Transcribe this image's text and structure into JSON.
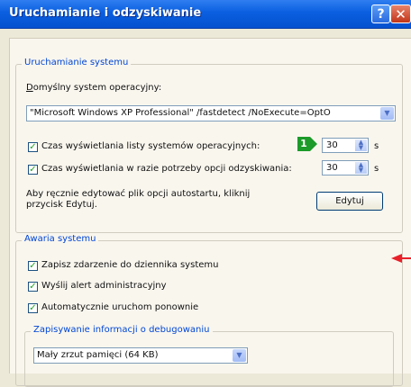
{
  "window": {
    "title": "Uruchamianie i odzyskiwanie",
    "help_glyph": "?",
    "close_glyph": "✕"
  },
  "startup": {
    "group_title": "Uruchamianie systemu",
    "default_os_label_prefix": "D",
    "default_os_label_rest": "omyślny system operacyjny:",
    "default_os_value": "\"Microsoft Windows XP Professional\" /fastdetect /NoExecute=OptO",
    "show_os_list_label": "Czas wyświetlania listy systemów operacyjnych:",
    "show_os_list_checked": true,
    "show_os_list_value": "30",
    "show_recovery_label": "Czas wyświetlania w razie potrzeby opcji odzyskiwania:",
    "show_recovery_checked": true,
    "show_recovery_value": "30",
    "seconds_unit": "s",
    "edit_hint": "Aby ręcznie edytować plik opcji autostartu, kliknij przycisk Edytuj.",
    "edit_button": "Edytuj"
  },
  "failure": {
    "group_title": "Awaria systemu",
    "write_event_label": "Zapisz zdarzenie do dziennika systemu",
    "write_event_checked": true,
    "send_alert_label": "Wyślij alert administracyjny",
    "send_alert_checked": true,
    "auto_restart_label": "Automatycznie uruchom ponownie",
    "auto_restart_checked": true,
    "debug_group_title": "Zapisywanie informacji o debugowaniu",
    "debug_value": "Mały zrzut pamięci (64 KB)"
  },
  "annotation": {
    "badge_number": "1",
    "badge_color": "#1c9a2a",
    "arrow_color": "#e8202a"
  },
  "glyphs": {
    "check": "✓",
    "dropdown": "▼",
    "spin_up": "▲",
    "spin_down": "▼"
  }
}
